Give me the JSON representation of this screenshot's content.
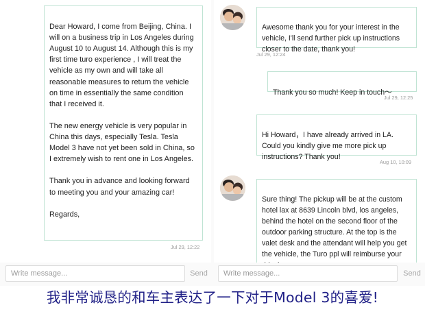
{
  "left_pane": {
    "message": {
      "text": "Dear Howard,   I come from Beijing, China. I will on a business trip in Los Angeles during August 10 to August 14. Although this is my first time turo experience , I will treat the vehicle as my own and will take all reasonable measures to return the vehicle on time in essentially the same condition that I received it.\n\nThe new energy vehicle is very popular in China this days, especially Tesla. Tesla Model 3 have not yet been sold in China, so I extremely wish to rent one in Los Angeles.\n\nThank you in advance and looking forward to meeting you and your amazing car!\n\nRegards,",
      "timestamp": "Jul 29, 12:22"
    },
    "composer": {
      "placeholder": "Write message...",
      "send_label": "Send"
    }
  },
  "right_pane": {
    "messages": [
      {
        "text": "Awesome thank you for your interest in the vehicle, I'll send further pick up instructions closer to the date, thank you!",
        "timestamp": "Jul 29, 12:24"
      },
      {
        "text": "Thank you so much!   Keep in touch～",
        "timestamp": "Jul 29, 12:25"
      },
      {
        "text": "Hi Howard，I have already arrived in LA. Could you kindly give me more pick up instructions?  Thank you!",
        "timestamp": "Aug 10, 10:09"
      },
      {
        "text": "Sure thing! The pickup will be at the custom hotel lax at 8639 Lincoln blvd, los angeles, behind the hotel on the second floor of the outdoor parking structure. At the top is the valet desk and the attendant will help you get the vehicle, the Turo ppl will reimburse your rideshare"
      }
    ],
    "composer": {
      "placeholder": "Write message...",
      "send_label": "Send"
    }
  },
  "caption": "我非常诚恳的和车主表达了一下对于Model 3的喜爱!",
  "colors": {
    "bubble_border": "#bfe3d3",
    "caption": "#1f1f86",
    "timestamp": "#9a9a9a"
  },
  "icons": {
    "host_avatar": "host-avatar-photo"
  }
}
